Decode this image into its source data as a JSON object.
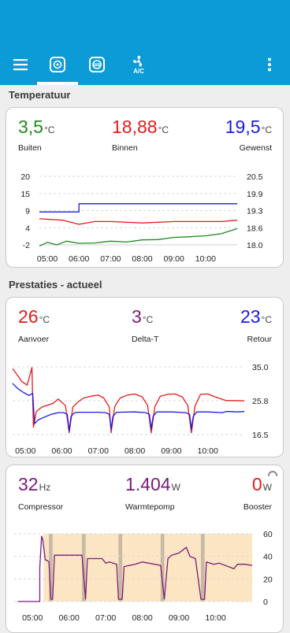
{
  "appbar": {
    "menu_icon": "hamburger-menu-icon",
    "tabs": [
      {
        "icon": "thermostat-dial-icon",
        "active": true
      },
      {
        "icon": "gauge-icon",
        "active": false
      },
      {
        "icon": "fan-ac-icon",
        "label": "A/C",
        "active": false
      }
    ],
    "overflow_icon": "more-vert-icon"
  },
  "temperature": {
    "section_title": "Temperatuur",
    "readings": [
      {
        "value": "3,5",
        "unit": "°C",
        "label": "Buiten",
        "color": "#1e8a1e"
      },
      {
        "value": "18,88",
        "unit": "°C",
        "label": "Binnen",
        "color": "#e31b1b"
      },
      {
        "value": "19,5",
        "unit": "°C",
        "label": "Gewenst",
        "color": "#1a1ae6"
      }
    ]
  },
  "performance": {
    "section_title": "Prestaties - actueel",
    "readings": [
      {
        "value": "26",
        "unit": "°C",
        "label": "Aanvoer",
        "color": "#e31b1b"
      },
      {
        "value": "3",
        "unit": "°C",
        "label": "Delta-T",
        "color": "#7a1b7a"
      },
      {
        "value": "23",
        "unit": "°C",
        "label": "Retour",
        "color": "#1a1ae6"
      }
    ]
  },
  "power": {
    "readings": [
      {
        "value": "32",
        "unit": "Hz",
        "label": "Compressor",
        "color": "#7a1b7a"
      },
      {
        "value": "1.404",
        "unit": "W",
        "label": "Warmtepomp",
        "color": "#7a1b7a"
      },
      {
        "value": "0",
        "unit": "W",
        "label": "Booster",
        "color": "#e31b1b"
      }
    ],
    "loading_icon": "refresh-spinner-icon"
  },
  "chart_data": [
    {
      "type": "line",
      "x_ticks": [
        "05:00",
        "06:00",
        "07:00",
        "08:00",
        "09:00",
        "10:00"
      ],
      "y_left_ticks": [
        "20",
        "15",
        "9",
        "4",
        "-2"
      ],
      "y_right_ticks": [
        "20.5",
        "19.9",
        "19.3",
        "18.6",
        "18.0"
      ],
      "ylim_left": [
        -2,
        20
      ],
      "ylim_right": [
        18.0,
        20.5
      ],
      "grid": true,
      "series": [
        {
          "color": "#1a1ae6",
          "axis": "right",
          "x": [
            4.75,
            6.0,
            6.0,
            11.0
          ],
          "y": [
            19.2,
            19.2,
            19.5,
            19.5
          ]
        },
        {
          "color": "#e31b1b",
          "axis": "right",
          "x": [
            4.75,
            5.5,
            6.0,
            6.5,
            7.0,
            8.0,
            9.0,
            10.0,
            10.5,
            11.0
          ],
          "y": [
            18.95,
            18.9,
            18.75,
            18.85,
            18.85,
            18.8,
            18.85,
            18.85,
            18.85,
            18.9
          ]
        },
        {
          "color": "#1e8a1e",
          "axis": "left",
          "x": [
            4.75,
            5.0,
            5.3,
            5.6,
            6.0,
            6.5,
            7.0,
            7.5,
            8.0,
            8.5,
            9.0,
            9.5,
            10.0,
            10.5,
            11.0
          ],
          "y": [
            -2.4,
            -1.2,
            -2.0,
            -0.8,
            -1.5,
            -1.4,
            -0.8,
            -1.1,
            -0.4,
            -0.3,
            0.4,
            0.6,
            0.9,
            1.6,
            3.2
          ]
        }
      ]
    },
    {
      "type": "line",
      "x_ticks": [
        "05:00",
        "06:00",
        "07:00",
        "08:00",
        "09:00",
        "10:00"
      ],
      "y_ticks": [
        "35.0",
        "25.8",
        "16.5"
      ],
      "ylim": [
        16.5,
        35.0
      ],
      "grid": true,
      "series": [
        {
          "color": "#e31b1b",
          "x": [
            4.65,
            4.8,
            4.9,
            5.05,
            5.18,
            5.22,
            5.3,
            5.45,
            5.6,
            5.75,
            5.9,
            6.1,
            6.2,
            6.3,
            6.45,
            6.6,
            6.8,
            7.0,
            7.15,
            7.3,
            7.35,
            7.45,
            7.6,
            7.8,
            8.0,
            8.2,
            8.35,
            8.45,
            8.55,
            8.7,
            8.9,
            9.1,
            9.3,
            9.45,
            9.55,
            9.65,
            9.8,
            10.0,
            10.2,
            10.5,
            10.8,
            11.0
          ],
          "y": [
            34.5,
            32.5,
            31.0,
            30.0,
            34.8,
            18.5,
            22.8,
            24.0,
            24.5,
            25.0,
            26.2,
            24.4,
            17.0,
            24.0,
            25.5,
            26.5,
            27.0,
            27.3,
            26.5,
            24.0,
            17.0,
            24.2,
            26.5,
            27.3,
            27.6,
            26.8,
            24.5,
            17.0,
            24.2,
            27.0,
            27.5,
            27.6,
            26.8,
            24.5,
            17.0,
            24.3,
            27.5,
            27.6,
            26.8,
            25.8,
            25.8,
            25.7
          ]
        },
        {
          "color": "#1a1ae6",
          "x": [
            4.65,
            4.8,
            4.95,
            5.1,
            5.2,
            5.25,
            5.35,
            5.5,
            5.7,
            5.9,
            6.05,
            6.15,
            6.2,
            6.25,
            6.35,
            6.5,
            7.0,
            7.2,
            7.3,
            7.35,
            7.4,
            7.5,
            8.0,
            8.3,
            8.4,
            8.45,
            8.5,
            8.6,
            9.0,
            9.4,
            9.5,
            9.55,
            9.6,
            9.7,
            10.0,
            10.4,
            10.5,
            10.6,
            10.8,
            11.0
          ],
          "y": [
            30.5,
            29.0,
            28.0,
            27.2,
            27.8,
            19.5,
            20.5,
            21.2,
            22.0,
            22.5,
            22.5,
            22.0,
            17.5,
            21.5,
            22.5,
            22.6,
            22.6,
            22.5,
            22.0,
            18.0,
            21.5,
            22.6,
            22.7,
            22.5,
            22.0,
            18.0,
            21.5,
            22.7,
            22.7,
            22.5,
            22.0,
            18.0,
            21.5,
            22.7,
            22.7,
            22.5,
            22.8,
            22.8,
            22.7,
            22.8
          ]
        }
      ]
    },
    {
      "type": "area",
      "x_ticks": [
        "05:00",
        "06:00",
        "07:00",
        "08:00",
        "09:00",
        "10:00"
      ],
      "y_ticks": [
        "60",
        "40",
        "20",
        "0"
      ],
      "ylim": [
        0,
        60
      ],
      "grid": true,
      "background_areas": [
        {
          "from": 5.3,
          "to": 11.0,
          "color": "#fce5c3"
        }
      ],
      "bands": [
        {
          "from": 5.45,
          "to": 5.55,
          "color": "#c8b9a2"
        },
        {
          "from": 6.35,
          "to": 6.45,
          "color": "#c8b9a2"
        },
        {
          "from": 7.35,
          "to": 7.45,
          "color": "#c8b9a2"
        },
        {
          "from": 8.5,
          "to": 8.6,
          "color": "#c8b9a2"
        },
        {
          "from": 9.6,
          "to": 9.7,
          "color": "#c8b9a2"
        }
      ],
      "series": [
        {
          "color": "#7a1b7a",
          "x": [
            4.6,
            5.2,
            5.2,
            5.25,
            5.28,
            5.35,
            5.42,
            5.45,
            5.5,
            5.55,
            5.6,
            6.0,
            6.3,
            6.35,
            6.45,
            6.5,
            6.9,
            7.0,
            7.1,
            7.3,
            7.35,
            7.45,
            7.5,
            7.8,
            8.0,
            8.5,
            8.6,
            8.7,
            8.8,
            9.0,
            9.2,
            9.25,
            9.3,
            9.45,
            9.6,
            9.7,
            9.75,
            9.95,
            10.1,
            10.5,
            10.6,
            10.8,
            11.0
          ],
          "y": [
            0,
            0,
            30,
            58,
            55,
            37,
            36,
            35,
            2,
            2,
            41,
            41,
            41,
            41,
            2,
            38,
            38,
            34,
            35,
            33,
            2,
            2,
            31,
            33,
            35,
            32,
            2,
            38,
            41,
            43,
            48,
            44,
            40,
            38,
            2,
            2,
            35,
            33,
            34,
            29,
            33,
            33,
            32
          ]
        }
      ]
    }
  ]
}
